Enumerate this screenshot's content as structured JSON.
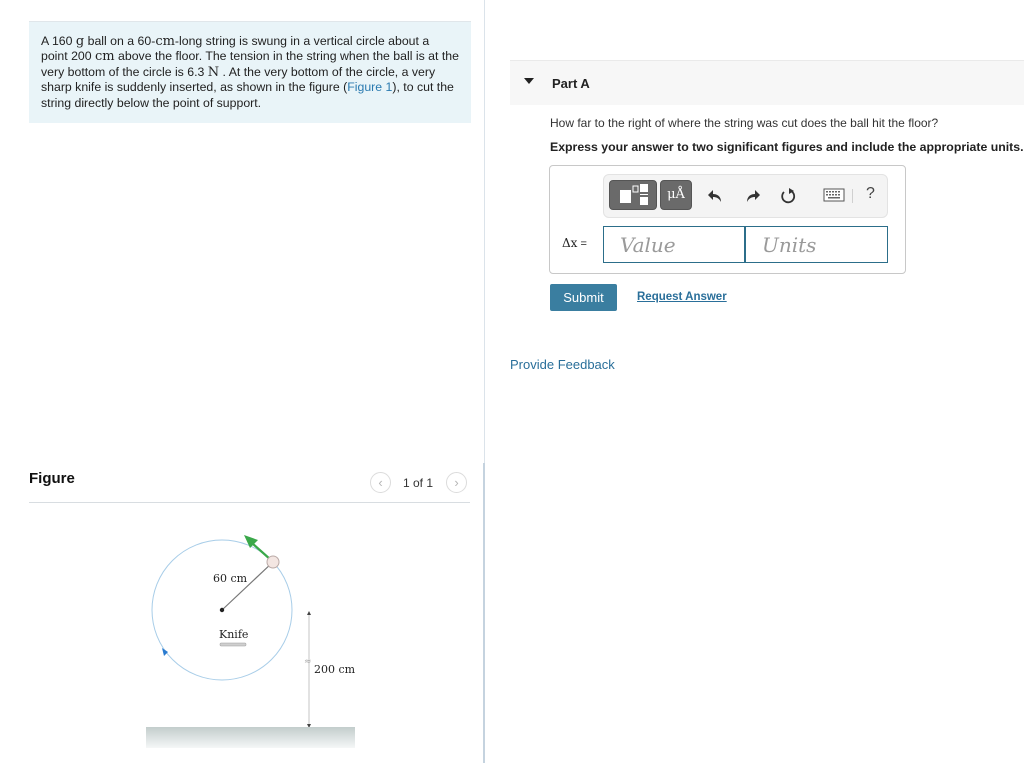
{
  "problem": {
    "segments": [
      {
        "t": "A 160 "
      },
      {
        "t": "g",
        "unit": true
      },
      {
        "t": " ball on a 60-"
      },
      {
        "t": "cm",
        "unit": true
      },
      {
        "t": "-long string is swung in a vertical circle about a point 200 "
      },
      {
        "t": "cm",
        "unit": true
      },
      {
        "t": " above the floor. The tension in the string when the ball is at the very bottom of the circle is 6.3 "
      },
      {
        "t": "N",
        "unit": true
      },
      {
        "t": " . At the very bottom of the circle, a very sharp knife is suddenly inserted, as shown in the figure ("
      },
      {
        "t": "Figure 1",
        "link": true
      },
      {
        "t": "), to cut the string directly below the point of support."
      }
    ]
  },
  "figure": {
    "title": "Figure",
    "pager": "1 of 1",
    "prev_icon": "chevron-left-icon",
    "next_icon": "chevron-right-icon",
    "labels": {
      "radius": "60 cm",
      "knife": "Knife",
      "height": "200 cm",
      "break_mark": "≈"
    },
    "colors": {
      "circle": "#a8cde8",
      "velocity_arrow": "#3aa84a",
      "ball": "#f3e6e2",
      "floor": "#c6cfcf"
    }
  },
  "part": {
    "title": "Part A",
    "question": "How far to the right of where the string was cut does the ball hit the floor?",
    "instruction": "Express your answer to two significant figures and include the appropriate units."
  },
  "answer": {
    "label_var": "Δx",
    "label_eq": " =",
    "value_placeholder": "Value",
    "units_placeholder": "Units",
    "toolbar": {
      "templates_icon": "templates-icon",
      "units_label": "μÅ",
      "undo_icon": "undo-icon",
      "redo_icon": "redo-icon",
      "reset_icon": "reset-icon",
      "keyboard_icon": "keyboard-icon",
      "help_label": "?"
    }
  },
  "actions": {
    "submit": "Submit",
    "request_answer": "Request Answer",
    "provide_feedback": "Provide Feedback"
  },
  "colors": {
    "accent": "#3a7ea0",
    "link": "#2a6f9a",
    "problem_bg": "#e9f4f8"
  }
}
